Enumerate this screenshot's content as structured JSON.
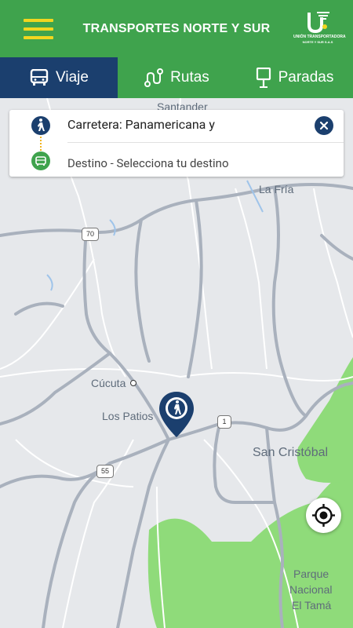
{
  "header": {
    "title": "TRANSPORTES NORTE Y SUR",
    "logo_line1": "UNIÓN TRANSPORTADORA",
    "logo_line2": "NORTE Y SUR S.A.S"
  },
  "tabs": [
    {
      "label": "Viaje",
      "icon": "bus-icon",
      "active": true
    },
    {
      "label": "Rutas",
      "icon": "route-icon",
      "active": false
    },
    {
      "label": "Paradas",
      "icon": "stop-sign-icon",
      "active": false
    }
  ],
  "trip": {
    "origin": "Carretera: Panamericana y",
    "destination": "Destino - Selecciona tu destino"
  },
  "map": {
    "labels": {
      "santander": "Santander",
      "la_fria": "La Fría",
      "cucuta": "Cúcuta",
      "los_patios": "Los Patios",
      "san_cristobal": "San Cristóbal",
      "parque_l1": "Parque",
      "parque_l2": "Nacional",
      "parque_l3": "El Tamá"
    },
    "shields": {
      "r70": "70",
      "r1": "1",
      "r55": "55"
    }
  },
  "colors": {
    "primary_green": "#3fa34d",
    "navy": "#1b3f6e",
    "accent_yellow": "#f1d61f"
  }
}
